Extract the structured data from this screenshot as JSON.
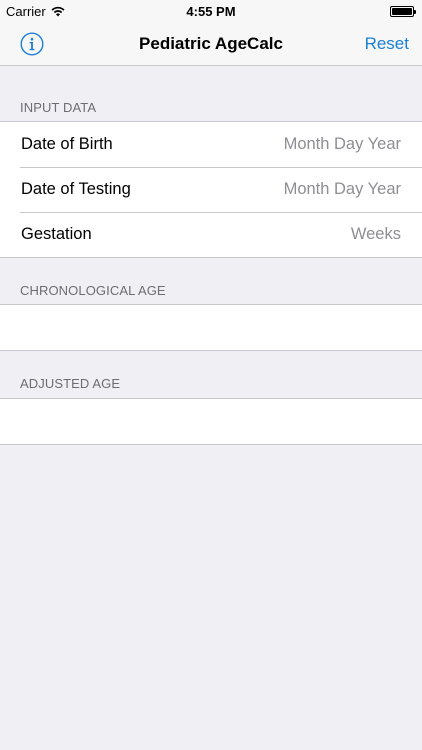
{
  "status_bar": {
    "carrier": "Carrier",
    "time": "4:55 PM",
    "wifi_icon": "wifi-icon",
    "battery_level": 1.0
  },
  "nav": {
    "title": "Pediatric AgeCalc",
    "info_icon": "info-icon",
    "reset_label": "Reset",
    "accent_color": "#1a7fd4"
  },
  "sections": {
    "input": {
      "header": "INPUT DATA",
      "rows": [
        {
          "label": "Date of Birth",
          "placeholder": "Month Day Year"
        },
        {
          "label": "Date of Testing",
          "placeholder": "Month Day Year"
        },
        {
          "label": "Gestation",
          "placeholder": "Weeks"
        }
      ]
    },
    "chronological": {
      "header": "CHRONOLOGICAL AGE",
      "value": ""
    },
    "adjusted": {
      "header": "ADJUSTED AGE",
      "value": ""
    }
  }
}
